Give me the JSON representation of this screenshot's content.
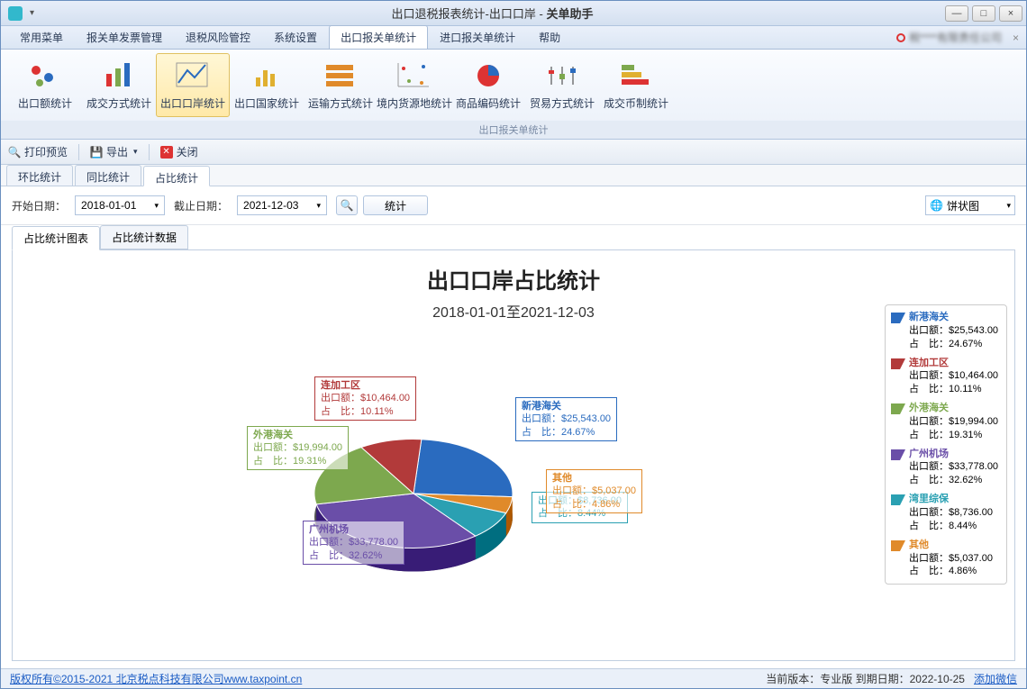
{
  "titlebar": {
    "title_left": "出口退税报表统计-出口口岸",
    "title_right": "关单助手"
  },
  "winbtns": {
    "min": "—",
    "max": "□",
    "close": "×"
  },
  "menubar": {
    "items": [
      "常用菜单",
      "报关单发票管理",
      "退税风险管控",
      "系统设置",
      "出口报关单统计",
      "进口报关单统计",
      "帮助"
    ],
    "active": 4,
    "company": "税****有限责任公司"
  },
  "ribbon": {
    "group_label": "出口报关单统计",
    "buttons": [
      {
        "label": "出口额统计"
      },
      {
        "label": "成交方式统计"
      },
      {
        "label": "出口口岸统计"
      },
      {
        "label": "出口国家统计"
      },
      {
        "label": "运输方式统计"
      },
      {
        "label": "境内货源地统计"
      },
      {
        "label": "商品编码统计"
      },
      {
        "label": "贸易方式统计"
      },
      {
        "label": "成交币制统计"
      }
    ],
    "active": 2
  },
  "toolbar": {
    "print": "打印预览",
    "export": "导出",
    "close": "关闭"
  },
  "stat_tabs": {
    "items": [
      "环比统计",
      "同比统计",
      "占比统计"
    ],
    "active": 2
  },
  "filters": {
    "start_label": "开始日期：",
    "start_value": "2018-01-01",
    "end_label": "截止日期：",
    "end_value": "2021-12-03",
    "go": "统计",
    "chart_type": "饼状图"
  },
  "subtabs": {
    "items": [
      "占比统计图表",
      "占比统计数据"
    ],
    "active": 0
  },
  "chart": {
    "title": "出口口岸占比统计",
    "subtitle": "2018-01-01至2021-12-03"
  },
  "chart_data": {
    "type": "pie",
    "title": "出口口岸占比统计",
    "subtitle": "2018-01-01至2021-12-03",
    "value_label": "出口额",
    "percent_label": "占　比",
    "series": [
      {
        "name": "新港海关",
        "value": 25543.0,
        "value_fmt": "$25,543.00",
        "percent": 24.67,
        "color": "#2a6bbf"
      },
      {
        "name": "连加工区",
        "value": 10464.0,
        "value_fmt": "$10,464.00",
        "percent": 10.11,
        "color": "#b23a3a"
      },
      {
        "name": "外港海关",
        "value": 19994.0,
        "value_fmt": "$19,994.00",
        "percent": 19.31,
        "color": "#7da84e"
      },
      {
        "name": "广州机场",
        "value": 33778.0,
        "value_fmt": "$33,778.00",
        "percent": 32.62,
        "color": "#6a4ea8"
      },
      {
        "name": "湾里综保",
        "value": 8736.0,
        "value_fmt": "$8,736.00",
        "percent": 8.44,
        "color": "#2aa0b2"
      },
      {
        "name": "其他",
        "value": 5037.0,
        "value_fmt": "$5,037.00",
        "percent": 4.86,
        "color": "#e08a2a"
      }
    ]
  },
  "footer": {
    "copyright": "版权所有©2015-2021 北京税点科技有限公司www.taxpoint.cn",
    "version_label": "当前版本：专业版  到期日期：2022-10-25",
    "add_wx": "添加微信"
  }
}
